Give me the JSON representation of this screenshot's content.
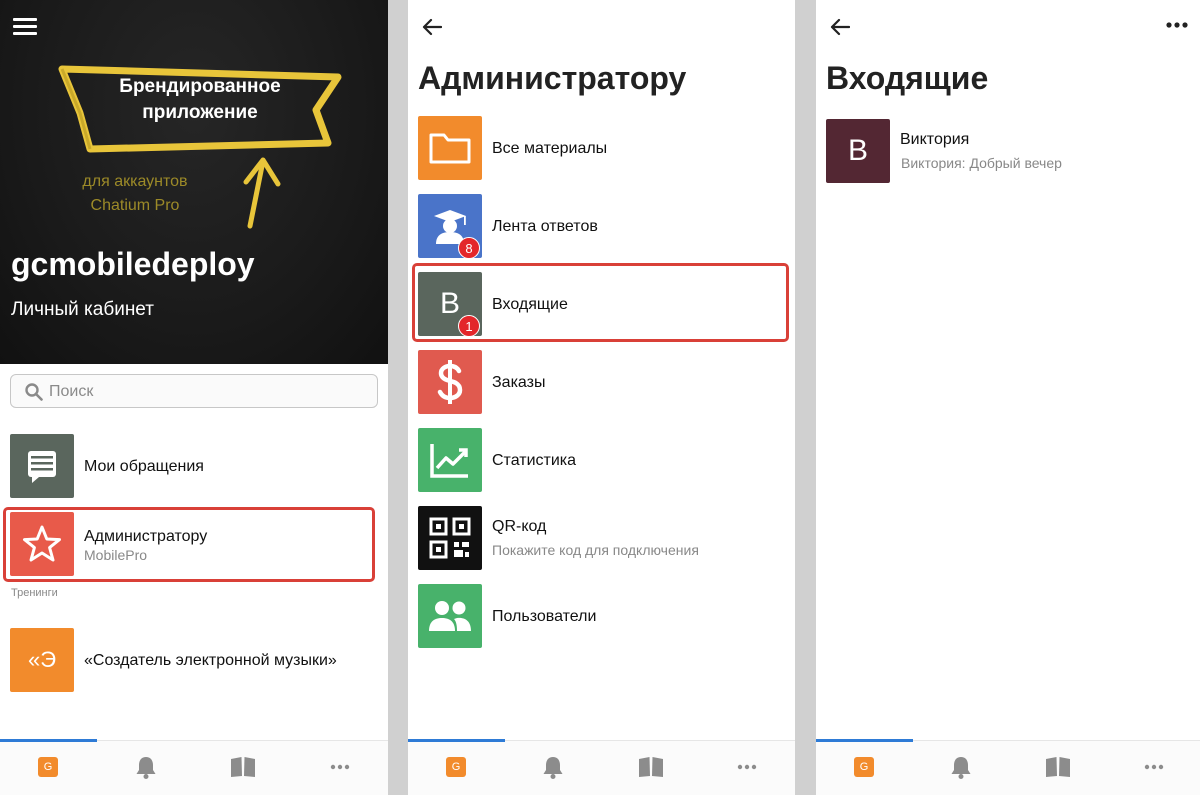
{
  "panel1": {
    "banner_line1": "Брендированное",
    "banner_line2": "приложение",
    "promo_line1": "для аккаунтов",
    "promo_line2": "Chatium Pro",
    "app_name": "gcmobiledeploy",
    "app_subtitle": "Личный кабинет",
    "search_placeholder": "Поиск",
    "items": [
      {
        "title": "Мои обращения",
        "subtitle": ""
      },
      {
        "title": "Администратору",
        "subtitle": "MobilePro"
      }
    ],
    "section_label": "Тренинги",
    "training_item": {
      "icon_text": "«Э",
      "title": "«Создатель электронной музыки»"
    }
  },
  "panel2": {
    "title": "Администратору",
    "items": [
      {
        "title": "Все материалы",
        "subtitle": "",
        "badge": ""
      },
      {
        "title": "Лента ответов",
        "subtitle": "",
        "badge": "8"
      },
      {
        "title": "Входящие",
        "subtitle": "",
        "badge": "1",
        "icon_text": "В"
      },
      {
        "title": "Заказы",
        "subtitle": "",
        "badge": ""
      },
      {
        "title": "Статистика",
        "subtitle": "",
        "badge": ""
      },
      {
        "title": "QR-код",
        "subtitle": "Покажите код для подключения",
        "badge": ""
      },
      {
        "title": "Пользователи",
        "subtitle": "",
        "badge": ""
      }
    ]
  },
  "panel3": {
    "title": "Входящие",
    "conversation": {
      "avatar_text": "В",
      "name": "Виктория",
      "preview": "Виктория: Добрый вечер"
    }
  },
  "tabbar": {
    "home_label": "G"
  },
  "colors": {
    "accent": "#2e7bd6",
    "highlight": "#d94038",
    "orange": "#f28b2c",
    "blue_tile": "#4a74c9",
    "gray_tile": "#5a665d",
    "red_tile": "#e05a4f",
    "green_tile": "#48b26b",
    "avatar_maroon": "#532733"
  }
}
